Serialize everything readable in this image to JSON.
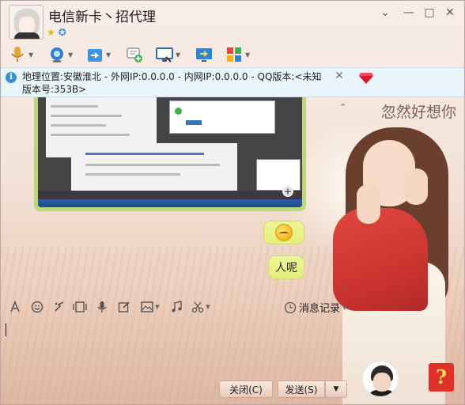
{
  "window": {
    "title": "电信新卡丶招代理",
    "controls": {
      "menu": "⌄",
      "minimize": "—",
      "maximize": "□",
      "close": "✕"
    }
  },
  "toolbar": {
    "items": [
      "voice-icon",
      "video-icon",
      "file-transfer-icon",
      "message-add-icon",
      "remote-desktop-icon",
      "screen-share-icon",
      "apps-icon"
    ]
  },
  "infobar": {
    "text": "地理位置:安徽淮北 - 外网IP:0.0.0.0 - 内网IP:0.0.0.0 - QQ版本:<未知版本号:353B>",
    "close": "✕"
  },
  "chat": {
    "messages": [
      {
        "type": "image",
        "description_icon": "screenshot-image"
      },
      {
        "type": "emoji",
        "icon": "sweat-emoji-icon"
      },
      {
        "type": "text",
        "text": "人呢"
      }
    ],
    "decor_text": "忽然好想你"
  },
  "input": {
    "tools": [
      "font-icon",
      "emoji-icon",
      "shake-icon",
      "gif-icon",
      "voice-message-icon",
      "edit-icon",
      "image-icon",
      "music-icon",
      "scissors-icon"
    ],
    "history_label": "消息记录",
    "value": ""
  },
  "buttons": {
    "close": "关闭(C)",
    "send": "发送(S)",
    "send_dropdown": "▼"
  },
  "colors": {
    "bubble": "#e8f080",
    "info_bg": "#e8f4fd",
    "help": "#e0302b"
  }
}
